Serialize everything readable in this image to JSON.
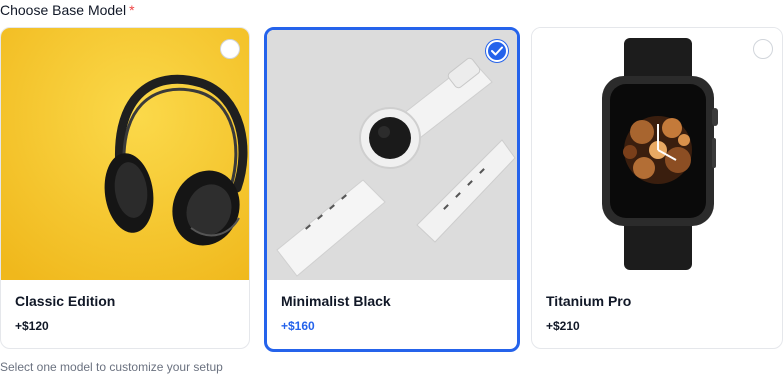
{
  "field": {
    "label": "Choose Base Model",
    "required_mark": "*"
  },
  "options": [
    {
      "name": "Classic Edition",
      "price": "+$120",
      "selected": false,
      "image": "headphones-photo"
    },
    {
      "name": "Minimalist Black",
      "price": "+$160",
      "selected": true,
      "image": "white-smartwatch-photo"
    },
    {
      "name": "Titanium Pro",
      "price": "+$210",
      "selected": false,
      "image": "black-smartwatch-photo"
    }
  ],
  "helper_text": "Select one model to customize your setup",
  "colors": {
    "accent": "#2563eb",
    "required": "#ef4444",
    "muted": "#6b7280",
    "border": "#e5e7eb"
  }
}
